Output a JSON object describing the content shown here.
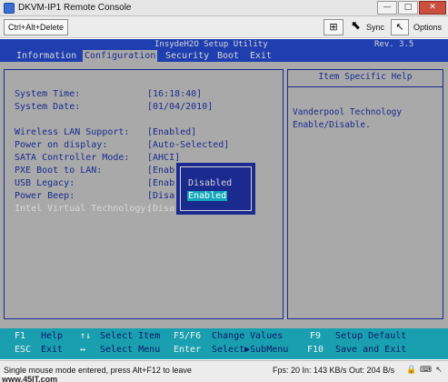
{
  "window": {
    "title": "DKVM-IP1 Remote Console",
    "buttons": {
      "minimize": "—",
      "maximize": "□",
      "close": "✕"
    }
  },
  "toolbar": {
    "ctrl_alt_del": "Ctrl+Alt+Delete",
    "fit_icon": "⊞",
    "sync_label": "Sync",
    "pointer_icon": "↖",
    "options_label": "Options",
    "cursor_icon": "⬉"
  },
  "bios": {
    "utility_title": "InsydeH2O Setup Utility",
    "rev": "Rev. 3.5",
    "menus": [
      {
        "label": "Information"
      },
      {
        "label": "Configuration"
      },
      {
        "label": "Security"
      },
      {
        "label": "Boot"
      },
      {
        "label": "Exit"
      }
    ],
    "active_menu": "Configuration",
    "settings": [
      {
        "label": "System Time:",
        "value": "[16:18:40]"
      },
      {
        "label": "System Date:",
        "value": "[01/04/2010]"
      },
      {
        "label": "Wireless LAN Support:",
        "value": "[Enabled]"
      },
      {
        "label": "Power on display:",
        "value": "[Auto-Selected]"
      },
      {
        "label": "SATA Controller Mode:",
        "value": "[AHCI]"
      },
      {
        "label": "PXE Boot to LAN:",
        "value": "[Enab"
      },
      {
        "label": "USB Legacy:",
        "value": "[Enab"
      },
      {
        "label": "Power Beep:",
        "value": "[Disa"
      },
      {
        "label": "Intel Virtual Technology:",
        "value": "[Disa"
      }
    ],
    "help": {
      "title": "Item Specific Help",
      "text": "Vanderpool Technology Enable/Disable."
    },
    "popup": {
      "options": [
        "Disabled",
        "Enabled"
      ],
      "selected": "Enabled"
    },
    "footer": {
      "row1": [
        {
          "key": "F1",
          "text": "Help"
        },
        {
          "key": "↑↓",
          "text": "Select Item"
        },
        {
          "key": "F5/F6",
          "text": "Change Values"
        },
        {
          "key": "F9",
          "text": "Setup Default"
        }
      ],
      "row2": [
        {
          "key": "ESC",
          "text": "Exit"
        },
        {
          "key": "↔",
          "text": "Select Menu"
        },
        {
          "key": "Enter",
          "text": "Select▶SubMenu"
        },
        {
          "key": "F10",
          "text": "Save and Exit"
        }
      ]
    },
    "colors": {
      "background": "#a9a9a9",
      "menubar": "#1f3fb0",
      "text": "#1b2a8f",
      "footer": "#1a9fb0",
      "highlight": "#11a6b8"
    }
  },
  "statusbar": {
    "left": "Single mouse mode entered, press Alt+F12 to leave",
    "right": "Fps: 20 In: 143 KB/s Out: 204 B/s",
    "icons": [
      "lock-icon",
      "keyboard-icon",
      "mouse-icon"
    ],
    "icon_glyphs": [
      "🔒",
      "⌨",
      "↖"
    ]
  },
  "watermark": "www.45IT.com"
}
